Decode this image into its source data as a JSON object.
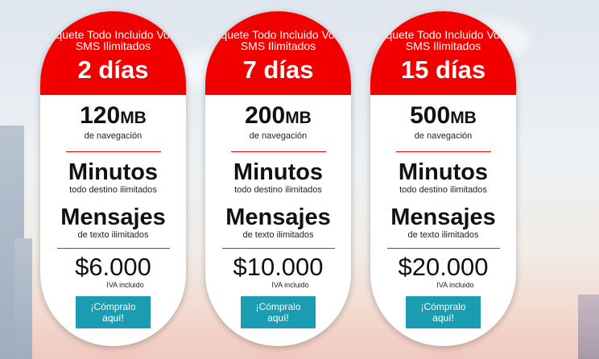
{
  "plans": [
    {
      "package_label": "Paquete Todo Incluido Voz y SMS Ilimitados",
      "duration": "2 días",
      "data_amount": "120",
      "data_unit": "MB",
      "data_caption": "de navegación",
      "minutes_title": "Minutos",
      "minutes_caption": "todo destino ilimitados",
      "messages_title": "Mensajes",
      "messages_caption": "de texto ilimitados",
      "price": "$6.000",
      "tax_note": "IVA incluido",
      "buy_label": "¡Cómpralo aquí!"
    },
    {
      "package_label": "Paquete Todo Incluido Voz y SMS Ilimitados",
      "duration": "7 días",
      "data_amount": "200",
      "data_unit": "MB",
      "data_caption": "de navegación",
      "minutes_title": "Minutos",
      "minutes_caption": "todo destino ilimitados",
      "messages_title": "Mensajes",
      "messages_caption": "de texto ilimitados",
      "price": "$10.000",
      "tax_note": "IVA incluido",
      "buy_label": "¡Cómpralo aquí!"
    },
    {
      "package_label": "Paquete Todo Incluido Voz y SMS Ilimitados",
      "duration": "15 días",
      "data_amount": "500",
      "data_unit": "MB",
      "data_caption": "de navegación",
      "minutes_title": "Minutos",
      "minutes_caption": "todo destino ilimitados",
      "messages_title": "Mensajes",
      "messages_caption": "de texto ilimitados",
      "price": "$20.000",
      "tax_note": "IVA incluido",
      "buy_label": "¡Cómpralo aquí!"
    }
  ],
  "colors": {
    "header_red": "#f20000",
    "rule_red": "#e00000",
    "button_teal": "#1a9cb3"
  }
}
